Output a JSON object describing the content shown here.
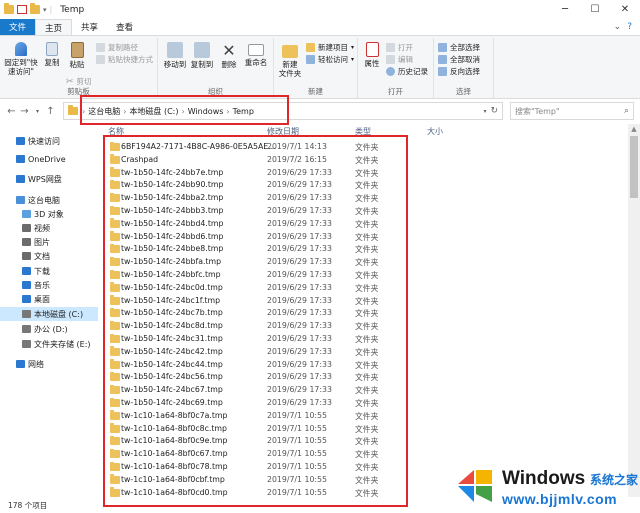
{
  "window": {
    "title": "Temp",
    "controls": [
      "─",
      "☐",
      "✕"
    ]
  },
  "ribbon_tabs": [
    {
      "label": "文件"
    },
    {
      "label": "主页"
    },
    {
      "label": "共享"
    },
    {
      "label": "查看"
    }
  ],
  "ribbon": {
    "clipboard": {
      "pin_quick_access": "固定到\"快\n速访问\"",
      "copy": "复制",
      "paste": "粘贴",
      "copy_path": "复制路径",
      "paste_shortcut": "粘贴快捷方式",
      "cut": "剪切",
      "group_label": "剪贴板"
    },
    "organize": {
      "move_to": "移动到",
      "copy_to": "复制到",
      "delete": "删除",
      "rename": "重命名",
      "group_label": "组织"
    },
    "new": {
      "new_folder": "新建\n文件夹",
      "new_item": "新建项目",
      "easy_access": "轻松访问",
      "group_label": "新建"
    },
    "open": {
      "properties": "属性",
      "open": "打开",
      "edit": "编辑",
      "history": "历史记录",
      "group_label": "打开"
    },
    "select": {
      "select_all": "全部选择",
      "select_none": "全部取消",
      "invert": "反向选择",
      "group_label": "选择"
    }
  },
  "address": {
    "crumbs": [
      "这台电脑",
      "本地磁盘 (C:)",
      "Windows",
      "Temp"
    ],
    "search_placeholder": "搜索\"Temp\""
  },
  "nav_pane": [
    {
      "label": "快速访问",
      "icon": "star-icon",
      "color": "#2b78d0"
    },
    {
      "label": "OneDrive",
      "icon": "cloud-icon",
      "color": "#2b78d0"
    },
    {
      "label": "WPS网盘",
      "icon": "cloud-icon",
      "color": "#2b78d0"
    },
    {
      "label": "这台电脑",
      "icon": "computer-icon",
      "color": "#4a90d9"
    },
    {
      "label": "3D 对象",
      "icon": "cube-icon",
      "color": "#5aa0e0"
    },
    {
      "label": "视频",
      "icon": "video-icon",
      "color": "#6b6b6b"
    },
    {
      "label": "图片",
      "icon": "picture-icon",
      "color": "#6b6b6b"
    },
    {
      "label": "文档",
      "icon": "document-icon",
      "color": "#6b6b6b"
    },
    {
      "label": "下载",
      "icon": "download-icon",
      "color": "#2b78d0"
    },
    {
      "label": "音乐",
      "icon": "music-icon",
      "color": "#2b78d0"
    },
    {
      "label": "桌面",
      "icon": "desktop-icon",
      "color": "#2b78d0"
    },
    {
      "label": "本地磁盘 (C:)",
      "icon": "drive-icon",
      "color": "#777777",
      "selected": true
    },
    {
      "label": "办公 (D:)",
      "icon": "drive-icon",
      "color": "#777777"
    },
    {
      "label": "文件夹存储 (E:)",
      "icon": "drive-icon",
      "color": "#777777"
    },
    {
      "label": "网络",
      "icon": "network-icon",
      "color": "#2b78d0"
    }
  ],
  "columns": {
    "name": "名称",
    "date": "修改日期",
    "type": "类型",
    "size": "大小"
  },
  "files": [
    {
      "name": "6BF194A2-7171-4B8C-A986-0E5A5AE...",
      "date": "2019/7/1 14:13",
      "type": "文件夹"
    },
    {
      "name": "Crashpad",
      "date": "2019/7/2 16:15",
      "type": "文件夹"
    },
    {
      "name": "tw-1b50-14fc-24bb7e.tmp",
      "date": "2019/6/29 17:33",
      "type": "文件夹"
    },
    {
      "name": "tw-1b50-14fc-24bb90.tmp",
      "date": "2019/6/29 17:33",
      "type": "文件夹"
    },
    {
      "name": "tw-1b50-14fc-24bba2.tmp",
      "date": "2019/6/29 17:33",
      "type": "文件夹"
    },
    {
      "name": "tw-1b50-14fc-24bbb3.tmp",
      "date": "2019/6/29 17:33",
      "type": "文件夹"
    },
    {
      "name": "tw-1b50-14fc-24bbd4.tmp",
      "date": "2019/6/29 17:33",
      "type": "文件夹"
    },
    {
      "name": "tw-1b50-14fc-24bbd6.tmp",
      "date": "2019/6/29 17:33",
      "type": "文件夹"
    },
    {
      "name": "tw-1b50-14fc-24bbe8.tmp",
      "date": "2019/6/29 17:33",
      "type": "文件夹"
    },
    {
      "name": "tw-1b50-14fc-24bbfa.tmp",
      "date": "2019/6/29 17:33",
      "type": "文件夹"
    },
    {
      "name": "tw-1b50-14fc-24bbfc.tmp",
      "date": "2019/6/29 17:33",
      "type": "文件夹"
    },
    {
      "name": "tw-1b50-14fc-24bc0d.tmp",
      "date": "2019/6/29 17:33",
      "type": "文件夹"
    },
    {
      "name": "tw-1b50-14fc-24bc1f.tmp",
      "date": "2019/6/29 17:33",
      "type": "文件夹"
    },
    {
      "name": "tw-1b50-14fc-24bc7b.tmp",
      "date": "2019/6/29 17:33",
      "type": "文件夹"
    },
    {
      "name": "tw-1b50-14fc-24bc8d.tmp",
      "date": "2019/6/29 17:33",
      "type": "文件夹"
    },
    {
      "name": "tw-1b50-14fc-24bc31.tmp",
      "date": "2019/6/29 17:33",
      "type": "文件夹"
    },
    {
      "name": "tw-1b50-14fc-24bc42.tmp",
      "date": "2019/6/29 17:33",
      "type": "文件夹"
    },
    {
      "name": "tw-1b50-14fc-24bc44.tmp",
      "date": "2019/6/29 17:33",
      "type": "文件夹"
    },
    {
      "name": "tw-1b50-14fc-24bc56.tmp",
      "date": "2019/6/29 17:33",
      "type": "文件夹"
    },
    {
      "name": "tw-1b50-14fc-24bc67.tmp",
      "date": "2019/6/29 17:33",
      "type": "文件夹"
    },
    {
      "name": "tw-1b50-14fc-24bc69.tmp",
      "date": "2019/6/29 17:33",
      "type": "文件夹"
    },
    {
      "name": "tw-1c10-1a64-8bf0c7a.tmp",
      "date": "2019/7/1 10:55",
      "type": "文件夹"
    },
    {
      "name": "tw-1c10-1a64-8bf0c8c.tmp",
      "date": "2019/7/1 10:55",
      "type": "文件夹"
    },
    {
      "name": "tw-1c10-1a64-8bf0c9e.tmp",
      "date": "2019/7/1 10:55",
      "type": "文件夹"
    },
    {
      "name": "tw-1c10-1a64-8bf0c67.tmp",
      "date": "2019/7/1 10:55",
      "type": "文件夹"
    },
    {
      "name": "tw-1c10-1a64-8bf0c78.tmp",
      "date": "2019/7/1 10:55",
      "type": "文件夹"
    },
    {
      "name": "tw-1c10-1a64-8bf0cbf.tmp",
      "date": "2019/7/1 10:55",
      "type": "文件夹"
    },
    {
      "name": "tw-1c10-1a64-8bf0cd0.tmp",
      "date": "2019/7/1 10:55",
      "type": "文件夹"
    }
  ],
  "status": {
    "item_count": "178 个项目"
  },
  "watermark": {
    "brand": "Windows",
    "brand_cn": "系统之家",
    "url": "www.bjjmlv.com"
  }
}
